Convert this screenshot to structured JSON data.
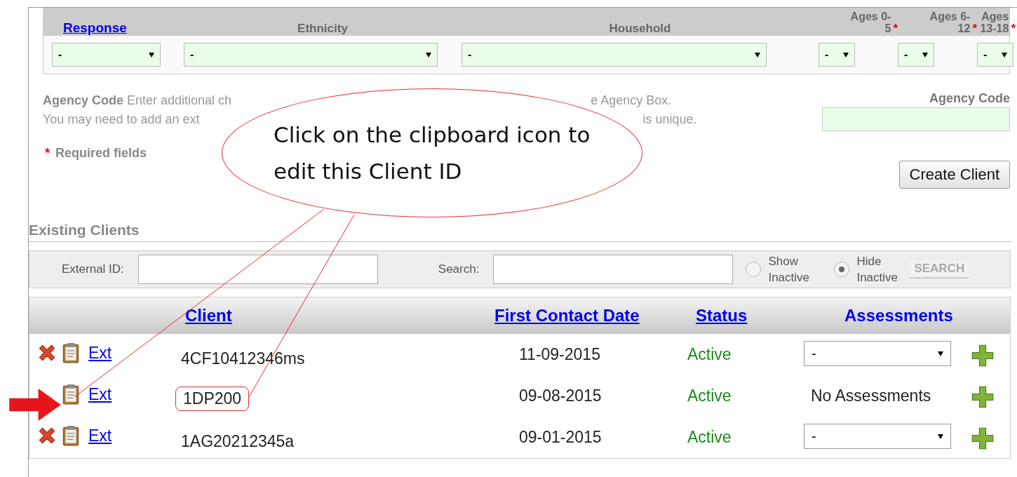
{
  "demographics": {
    "required_mark": "*",
    "columns": [
      {
        "label": "Response",
        "kind": "link"
      },
      {
        "label": "Ethnicity",
        "kind": "plain"
      },
      {
        "label": "Household",
        "kind": "plain"
      },
      {
        "label": "Ages 0-5",
        "kind": "required"
      },
      {
        "label": "Ages 6-12",
        "kind": "required"
      },
      {
        "label": "Ages 13-18",
        "kind": "required"
      }
    ],
    "selects": [
      "-",
      "-",
      "-",
      "-",
      "-",
      "-"
    ]
  },
  "agency": {
    "label": "Agency Code",
    "line_1_start": "Enter additional ch",
    "line_1_end": "e Agency Box.",
    "line_2_start": "You may need to add an ext",
    "line_2_end": "is unique.",
    "field_label": "Agency Code"
  },
  "required_note": {
    "mark": "*",
    "text": "Required fields"
  },
  "create_button": "Create Client",
  "existing": {
    "title": "Existing Clients",
    "external_id_label": "External ID:",
    "search_label": "Search:",
    "radios": [
      {
        "label": "Show Inactive",
        "selected": false
      },
      {
        "label": "Hide Inactive",
        "selected": true
      }
    ],
    "search_button": "SEARCH"
  },
  "table": {
    "columns": [
      "Client",
      "First Contact Date",
      "Status",
      "Assessments"
    ],
    "rows": [
      {
        "deletable": true,
        "link": "Ext",
        "client": "4CF10412346ms",
        "highlighted": false,
        "date": "11-09-2015",
        "status": "Active",
        "assessments": {
          "kind": "select",
          "value": "-"
        }
      },
      {
        "deletable": false,
        "link": "Ext",
        "client": "1DP200",
        "highlighted": true,
        "date": "09-08-2015",
        "status": "Active",
        "assessments": {
          "kind": "text",
          "value": "No Assessments"
        }
      },
      {
        "deletable": true,
        "link": "Ext",
        "client": "1AG20212345a",
        "highlighted": false,
        "date": "09-01-2015",
        "status": "Active",
        "assessments": {
          "kind": "select",
          "value": "-"
        }
      }
    ]
  },
  "callout": {
    "text": "Click on the clipboard icon to edit this Client ID"
  }
}
